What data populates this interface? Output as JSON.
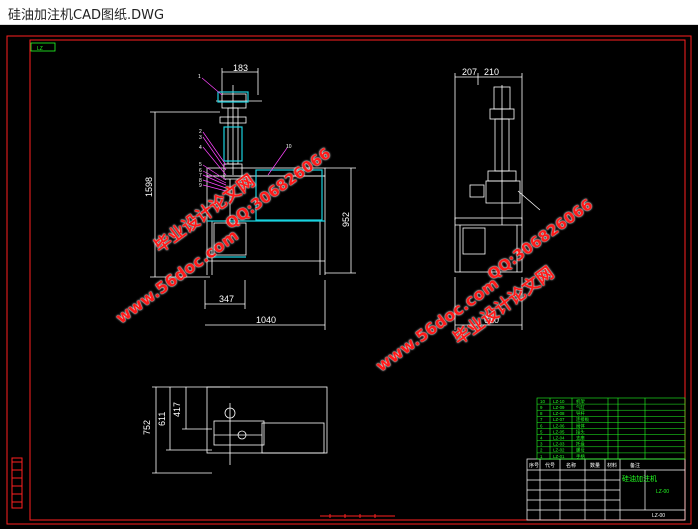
{
  "window": {
    "title": "硅油加注机CAD图纸.DWG"
  },
  "drawing": {
    "corner_tag": "LZ",
    "front_view": {
      "dims": {
        "top_width": "183",
        "height": "1598",
        "base_height": "952",
        "base_width": "347",
        "overall_width": "1040"
      },
      "balloons": [
        "1",
        "2",
        "3",
        "4",
        "5",
        "6",
        "7",
        "8",
        "9",
        "10"
      ]
    },
    "side_view": {
      "dims": {
        "left": "207",
        "right": "210",
        "width": "610"
      }
    },
    "top_view": {
      "dims": {
        "inner": "417",
        "mid": "611",
        "outer": "752"
      }
    },
    "title_block": {
      "name": "硅油加注机",
      "drawing_no": "LZ-00",
      "company": "LZ-00",
      "parts": [
        {
          "no": "10",
          "code": "LZ-10",
          "name": "机架"
        },
        {
          "no": "9",
          "code": "LZ-09",
          "name": "气缸"
        },
        {
          "no": "8",
          "code": "LZ-08",
          "name": "导杆"
        },
        {
          "no": "7",
          "code": "LZ-07",
          "name": "连接板"
        },
        {
          "no": "6",
          "code": "LZ-06",
          "name": "阀体"
        },
        {
          "no": "5",
          "code": "LZ-05",
          "name": "接头"
        },
        {
          "no": "4",
          "code": "LZ-04",
          "name": "支座"
        },
        {
          "no": "3",
          "code": "LZ-03",
          "name": "托盘"
        },
        {
          "no": "2",
          "code": "LZ-02",
          "name": "螺母"
        },
        {
          "no": "1",
          "code": "LZ-01",
          "name": "手柄"
        }
      ],
      "header": [
        "序号",
        "代号",
        "名称",
        "数量",
        "材料",
        "备注"
      ]
    }
  },
  "watermarks": [
    {
      "text": "毕业设计论文网"
    },
    {
      "text": "www.56doc.com"
    },
    {
      "text": "QQ:306826066"
    },
    {
      "text": "www.56doc.com"
    },
    {
      "text": "QQ:306826066"
    },
    {
      "text": "毕业设计论文网"
    }
  ],
  "colors": {
    "frame": "#ff2020",
    "geometry": "#ffffff",
    "highlight": "#19d3e0",
    "text_green": "#22ff22",
    "balloon": "#ff44ff",
    "watermark": "#ff1a1a"
  }
}
